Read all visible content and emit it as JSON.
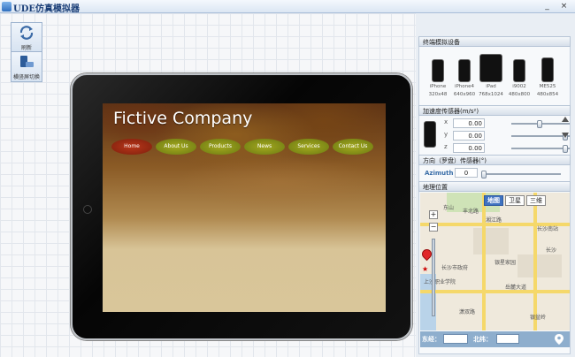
{
  "window": {
    "title": "UDE仿真模拟器",
    "min_label": "_",
    "close_label": "×"
  },
  "tools": {
    "refresh_label": "刷新",
    "switch_label": "横竖屏切换"
  },
  "site": {
    "title": "Fictive Company",
    "nav": [
      "Home",
      "About Us",
      "Products",
      "News",
      "Services",
      "Contact Us"
    ],
    "active": "Home"
  },
  "devices": {
    "heading": "终端模拟设备",
    "items": [
      {
        "name": "iPhone",
        "res": "320x48"
      },
      {
        "name": "iPhone4",
        "res": "640x960"
      },
      {
        "name": "iPad",
        "res": "768x1024"
      },
      {
        "name": "i9002",
        "res": "480x800"
      },
      {
        "name": "ME525",
        "res": "480x854"
      }
    ]
  },
  "accel": {
    "heading": "加速度传感器(m/s²)",
    "axes": [
      {
        "axis": "x",
        "value": "0.00",
        "pos": 0.5
      },
      {
        "axis": "y",
        "value": "0.00",
        "pos": 1.0
      },
      {
        "axis": "z",
        "value": "0.00",
        "pos": 1.0
      }
    ]
  },
  "compass": {
    "heading": "方向（罗盘）传感器(°)",
    "label": "Azimuth",
    "value": "0",
    "pos": 0.0
  },
  "geo": {
    "heading": "地理位置",
    "map_types": [
      "地图",
      "卫星",
      "三维"
    ],
    "active_type": "地图",
    "labels": [
      "东山",
      "丰北路",
      "湘江路",
      "长沙南站",
      "长沙市政府",
      "银星家园",
      "岳麓大道",
      "上沙职业学院",
      "潇双路",
      "银盆岭",
      "长沙"
    ],
    "lon_label": "东经：",
    "lat_label": "北纬："
  }
}
